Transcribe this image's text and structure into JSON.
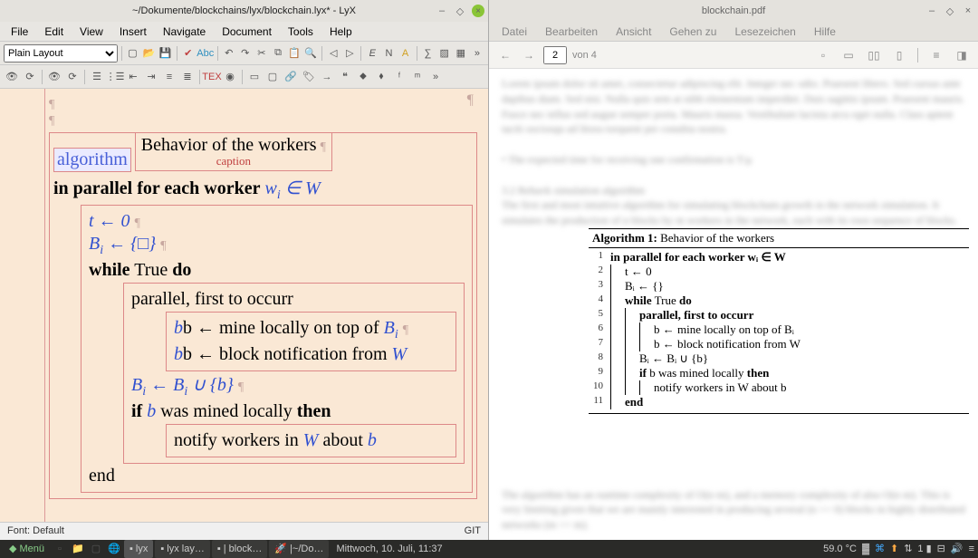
{
  "lyx": {
    "title": "~/Dokumente/blockchains/lyx/blockchain.lyx* - LyX",
    "menus": [
      "File",
      "Edit",
      "View",
      "Insert",
      "Navigate",
      "Document",
      "Tools",
      "Help"
    ],
    "paragraph_style": "Plain Layout",
    "status_left": "Font: Default",
    "status_right": "GIT"
  },
  "pdf": {
    "title": "blockchain.pdf",
    "menus": [
      "Datei",
      "Bearbeiten",
      "Ansicht",
      "Gehen zu",
      "Lesezeichen",
      "Hilfe"
    ],
    "page_current": "2",
    "page_of": "von 4"
  },
  "algo_editor": {
    "float_name": "algorithm",
    "caption_text": "Behavior of the workers",
    "caption_label": "caption",
    "line_parallel": "in parallel for each worker",
    "var_wi": "w",
    "sub_i": "i",
    "in": "∈",
    "set_W": "W",
    "line_t": "t ← 0",
    "line_Bi": "B",
    "line_Bi_rhs": " ← {□}",
    "while": "while",
    "true": "True",
    "do": "do",
    "parallel_first": "parallel, first to occurr",
    "b_mine": "b ← mine locally on top of ",
    "b_notif": "b ← block notification from ",
    "bi_union": " ← B",
    "union_b": " ∪ {b}",
    "if": "if",
    "mined_local": " was mined locally ",
    "then": "then",
    "notify": "notify workers in ",
    "about_b": " about ",
    "b": "b",
    "end": "end"
  },
  "algo_render": {
    "title_prefix": "Algorithm 1:",
    "title_text": " Behavior of the workers",
    "lines": [
      {
        "n": "1",
        "txt": "in parallel for each worker  wᵢ ∈ W",
        "bold": true,
        "indent": 0
      },
      {
        "n": "2",
        "txt": "t ← 0",
        "indent": 1
      },
      {
        "n": "3",
        "txt": "Bᵢ ← {}",
        "indent": 1
      },
      {
        "n": "4",
        "txt": "while True do",
        "indent": 1,
        "bold_parts": [
          "while",
          "do"
        ]
      },
      {
        "n": "5",
        "txt": "parallel, first to occurr",
        "indent": 2,
        "bold": true
      },
      {
        "n": "6",
        "txt": "b ← mine locally on top of Bᵢ",
        "indent": 3
      },
      {
        "n": "7",
        "txt": "b ← block notification from W",
        "indent": 3
      },
      {
        "n": "8",
        "txt": "Bᵢ ← Bᵢ ∪ {b}",
        "indent": 2
      },
      {
        "n": "9",
        "txt": "if b was mined locally then",
        "indent": 2,
        "bold_parts": [
          "if",
          "then"
        ]
      },
      {
        "n": "10",
        "txt": "notify workers in W about b",
        "indent": 3
      },
      {
        "n": "11",
        "txt": "end",
        "indent": 1,
        "bold": true
      }
    ]
  },
  "taskbar": {
    "menu": "Menü",
    "items": [
      "lyx",
      "lyx lay…",
      "| block…",
      "|~/Do…"
    ],
    "datetime": "Mittwoch, 10. Juli, 11:37",
    "temp": "59.0 °C"
  }
}
